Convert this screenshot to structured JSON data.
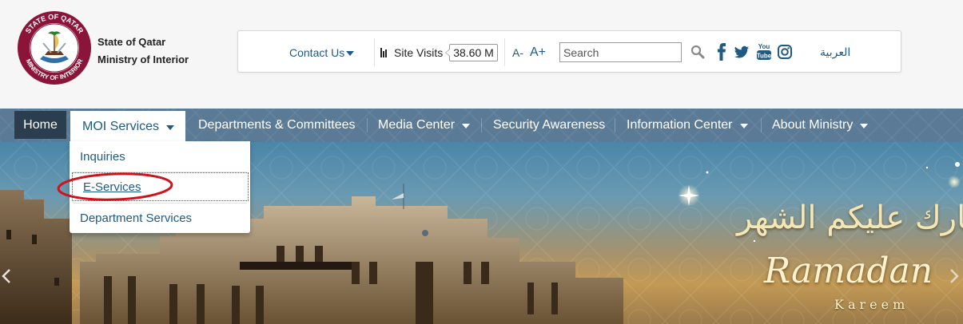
{
  "header": {
    "org_line1": "State of Qatar",
    "org_line2": "Ministry of Interior",
    "logo_text_top": "STATE OF QATAR",
    "logo_text_bottom": "MINISTRY OF INTERIOR"
  },
  "toolbar": {
    "contact_label": "Contact Us",
    "site_visits_label": "Site Visits",
    "site_visits_value": "38.60 M",
    "font_decrease": "A-",
    "font_increase": "A+",
    "search_placeholder": "Search",
    "social_icons": [
      "facebook-icon",
      "twitter-icon",
      "youtube-icon",
      "instagram-icon"
    ],
    "language_label": "العربية"
  },
  "nav": {
    "items": [
      {
        "label": "Home"
      },
      {
        "label": "MOI Services"
      },
      {
        "label": "Departments & Committees"
      },
      {
        "label": "Media Center"
      },
      {
        "label": "Security Awareness"
      },
      {
        "label": "Information Center"
      },
      {
        "label": "About Ministry"
      }
    ]
  },
  "dropdown": {
    "items": [
      {
        "label": "Inquiries"
      },
      {
        "label": "E-Services"
      },
      {
        "label": "Department Services"
      }
    ]
  },
  "hero": {
    "greeting_arabic": "مبارك عليكم الشهر",
    "ramadan_text": "Ramadan",
    "kareem_text": "Kareem"
  },
  "colors": {
    "link_blue": "#1e5a82",
    "nav_bg": "#5a7a96",
    "nav_active_dark": "#2b3e4f",
    "annotation_red": "#d0121b"
  }
}
